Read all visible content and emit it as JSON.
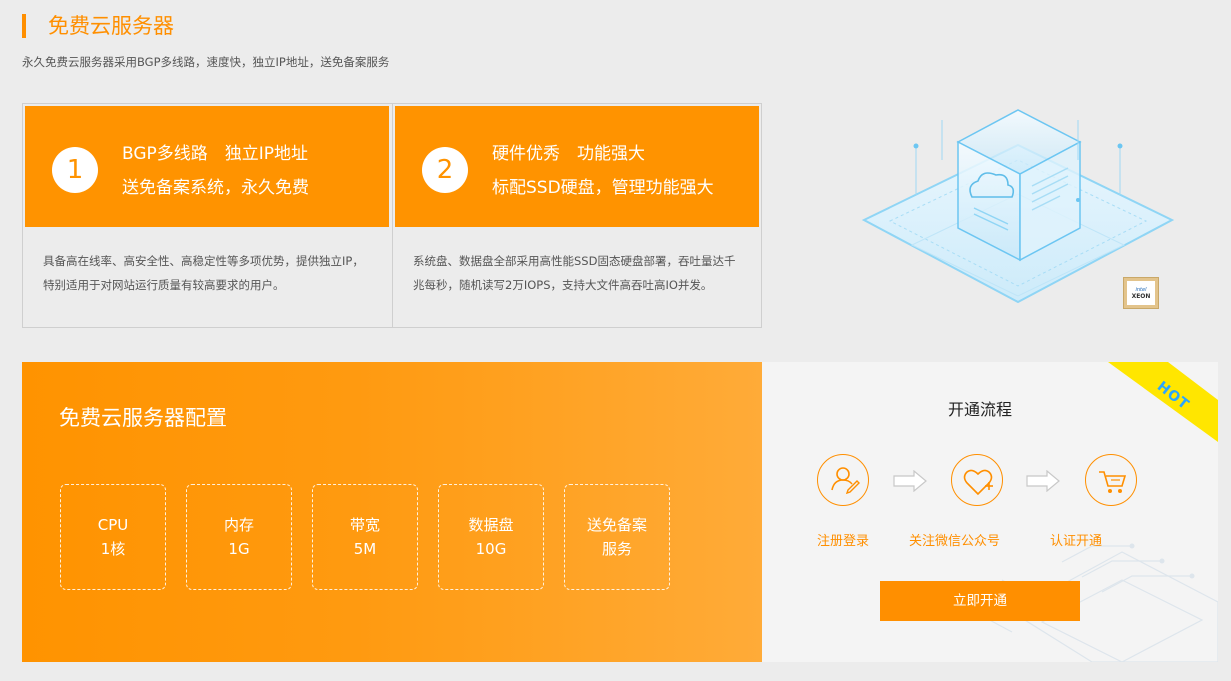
{
  "header": {
    "title": "免费云服务器",
    "subtitle": "永久免费云服务器采用BGP多线路，速度快，独立IP地址，送免备案服务"
  },
  "features": [
    {
      "number": "1",
      "line1": "BGP多线路　独立IP地址",
      "line2": "送免备案系统，永久免费",
      "desc": "具备高在线率、高安全性、高稳定性等多项优势，提供独立IP，特别适用于对网站运行质量有较高要求的用户。"
    },
    {
      "number": "2",
      "line1": "硬件优秀　功能强大",
      "line2": "标配SSD硬盘，管理功能强大",
      "desc": "系统盘、数据盘全部采用高性能SSD固态硬盘部署，吞吐量达千兆每秒，随机读写2万IOPS，支持大文件高吞吐高IO并发。"
    }
  ],
  "chip": {
    "brand": "intel",
    "model": "XEON"
  },
  "config": {
    "title": "免费云服务器配置",
    "specs": [
      {
        "name": "CPU",
        "value": "1核"
      },
      {
        "name": "内存",
        "value": "1G"
      },
      {
        "name": "带宽",
        "value": "5M"
      },
      {
        "name": "数据盘",
        "value": "10G"
      },
      {
        "name": "送免备案",
        "value": "服务"
      }
    ]
  },
  "process": {
    "title": "开通流程",
    "badge": "HOT",
    "steps": [
      {
        "label": "注册登录",
        "icon": "user-edit-icon"
      },
      {
        "label": "关注微信公众号",
        "icon": "heart-plus-icon"
      },
      {
        "label": "认证开通",
        "icon": "cart-icon"
      }
    ],
    "button": "立即开通"
  },
  "colors": {
    "accent": "#ff9300",
    "hot_ribbon": "#ffe600",
    "hot_text": "#2aa6ff",
    "illustration": "#6cc6f2"
  }
}
